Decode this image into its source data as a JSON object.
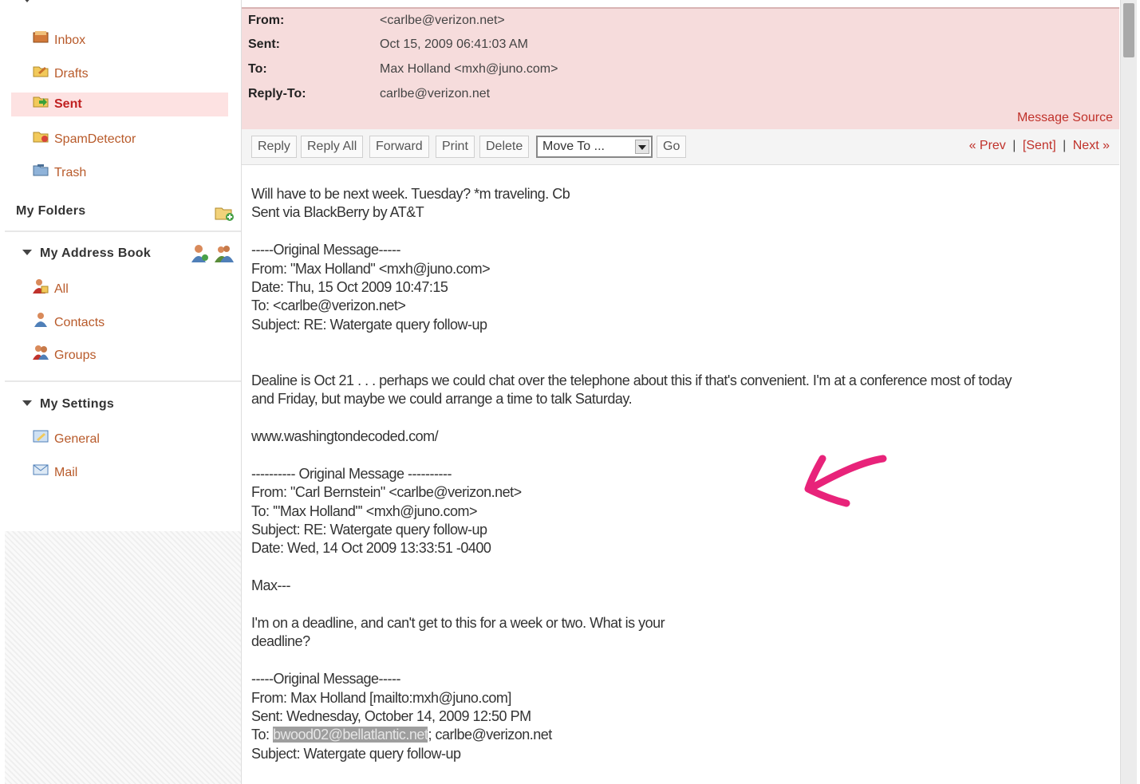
{
  "sidebar": {
    "messages_items": [
      {
        "label": "Inbox",
        "icon": "inbox-icon"
      },
      {
        "label": "Drafts",
        "icon": "drafts-icon"
      },
      {
        "label": "Sent",
        "icon": "sent-icon",
        "active": true
      },
      {
        "label": "SpamDetector",
        "icon": "spam-folder-icon"
      },
      {
        "label": "Trash",
        "icon": "trash-icon"
      }
    ],
    "my_folders_label": "My Folders",
    "address_book_label": "My Address Book",
    "address_items": [
      {
        "label": "All",
        "icon": "all-contacts-icon"
      },
      {
        "label": "Contacts",
        "icon": "contact-icon"
      },
      {
        "label": "Groups",
        "icon": "groups-icon"
      }
    ],
    "settings_label": "My Settings",
    "settings_items": [
      {
        "label": "General",
        "icon": "general-settings-icon"
      },
      {
        "label": "Mail",
        "icon": "mail-settings-icon"
      }
    ]
  },
  "header": {
    "from_label": "From:",
    "from_value": "<carlbe@verizon.net>",
    "sent_label": "Sent:",
    "sent_value": "Oct 15, 2009 06:41:03 AM",
    "to_label": "To:",
    "to_value": "Max Holland <mxh@juno.com>",
    "replyto_label": "Reply-To:",
    "replyto_value": "carlbe@verizon.net",
    "message_source": "Message Source"
  },
  "toolbar": {
    "reply": "Reply",
    "reply_all": "Reply All",
    "forward": "Forward",
    "print": "Print",
    "delete": "Delete",
    "move_to": "Move To ...",
    "go": "Go",
    "prev": "« Prev",
    "sent": "[Sent]",
    "next": "Next »",
    "sep": "|"
  },
  "body": {
    "l1": "Will have to be next week. Tuesday? *m traveling. Cb",
    "l2": "Sent via BlackBerry by AT&T",
    "l3": "-----Original Message-----",
    "l4": "From: \"Max Holland\" <mxh@juno.com>",
    "l5": "Date: Thu, 15 Oct 2009 10:47:15",
    "l6": "To: <carlbe@verizon.net>",
    "l7": "Subject: RE: Watergate query follow-up",
    "l8": "Dealine is Oct 21 . . . perhaps we could chat over the telephone about this if that's convenient. I'm at a conference most of today",
    "l9": "and Friday, but maybe we could arrange a time to talk Saturday.",
    "l10": "www.washingtondecoded.com/",
    "l11": "---------- Original Message ----------",
    "l12": "From: \"Carl Bernstein\" <carlbe@verizon.net>",
    "l13": "To: '\"Max Holland\"' <mxh@juno.com>",
    "l14": "Subject: RE: Watergate query follow-up",
    "l15": "Date: Wed, 14 Oct 2009 13:33:51 -0400",
    "l16": "Max---",
    "l17": "I'm on a deadline, and can't get to this for a week or two. What is your",
    "l18": "deadline?",
    "l19": "-----Original Message-----",
    "l20": "From: Max Holland [mailto:mxh@juno.com]",
    "l21": "Sent: Wednesday, October 14, 2009 12:50 PM",
    "l22_prefix": "To: ",
    "l22_highlight": "bwood02@bellatlantic.net",
    "l22_rest": "; carlbe@verizon.net",
    "l23": "Subject: Watergate query follow-up"
  },
  "colors": {
    "header_bg": "#f6dcdc",
    "link": "#c0322b",
    "nav_link": "#b85a2a",
    "active_bg": "#fde2e2",
    "annotation": "#e8237a"
  }
}
